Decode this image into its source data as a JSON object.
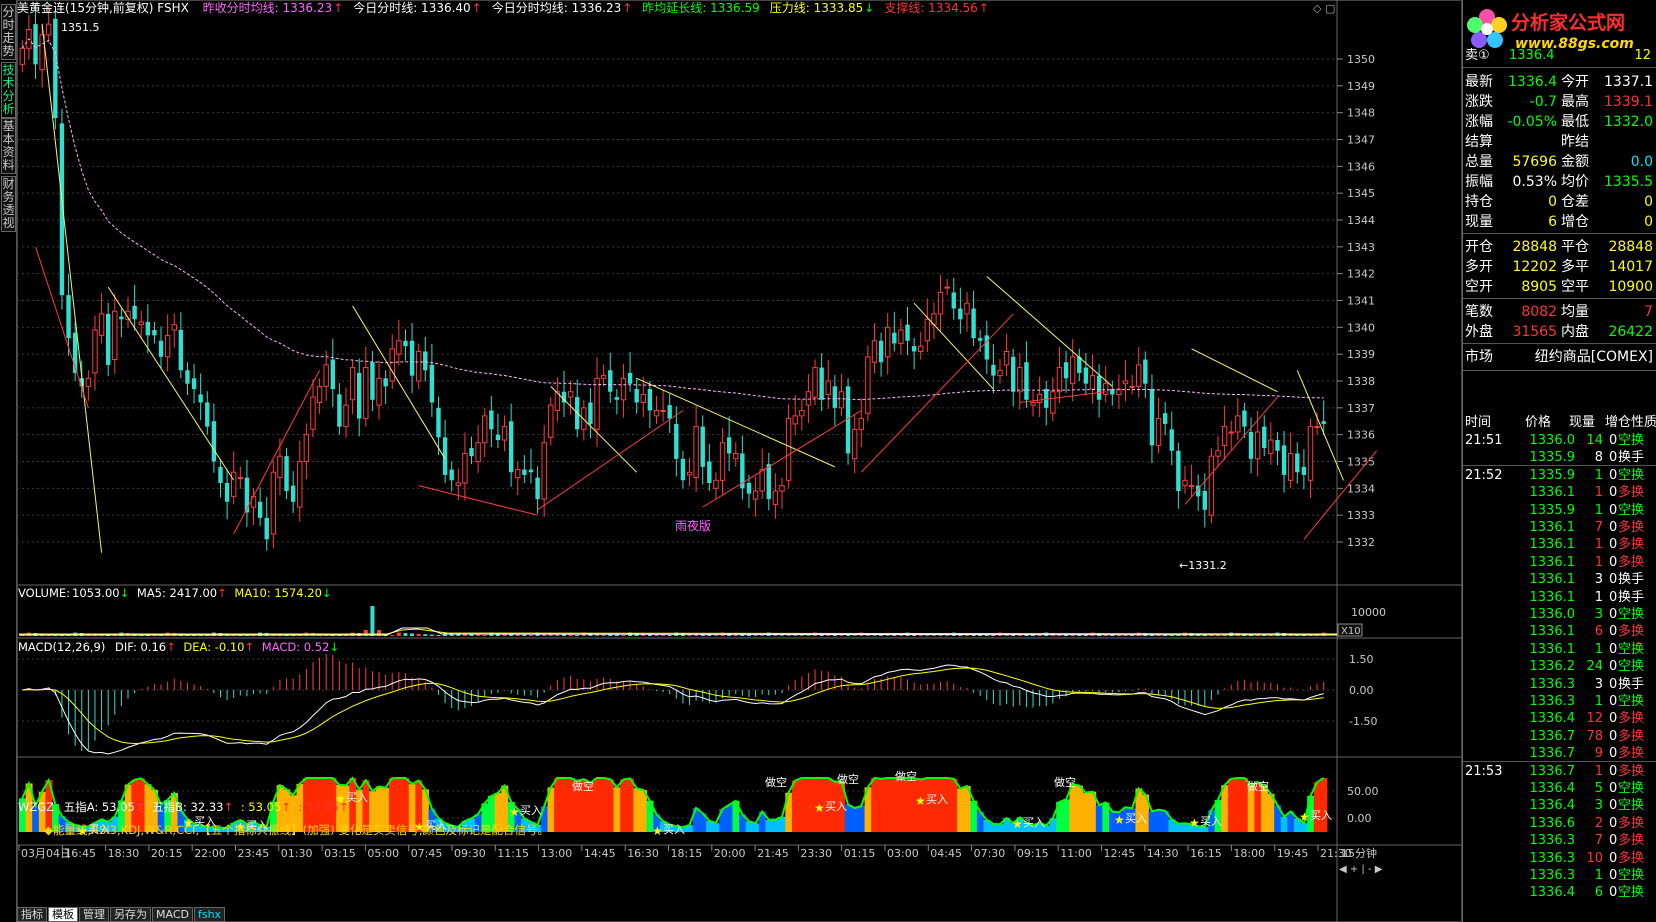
{
  "sidebar": {
    "tabs": [
      "分时走势",
      "技术分析",
      "基本资料",
      "财务透视"
    ],
    "active": 1
  },
  "topbar": {
    "symbol": "美黄金连(15分钟,前复权) FSHX",
    "lines": [
      {
        "label": "昨收分时均线:",
        "value": "1336.23",
        "arrow": "↑",
        "color": "#ff66ff"
      },
      {
        "label": "今日分时线:",
        "value": "1336.40",
        "arrow": "↑",
        "color": "#ffffff"
      },
      {
        "label": "今日分时均线:",
        "value": "1336.23",
        "arrow": "↑",
        "color": "#ffffff"
      },
      {
        "label": "昨均延长线:",
        "value": "1336.59",
        "arrow": "",
        "color": "#00ff00"
      },
      {
        "label": "压力线:",
        "value": "1333.85",
        "arrow": "↓",
        "color": "#ffff00"
      },
      {
        "label": "支撑线:",
        "value": "1334.56",
        "arrow": "↑",
        "color": "#ff3333"
      }
    ]
  },
  "price_axis": [
    "1350",
    "1349",
    "1348",
    "1347",
    "1346",
    "1345",
    "1344",
    "1343",
    "1342",
    "1341",
    "1340",
    "1339",
    "1338",
    "1337",
    "1336",
    "1335",
    "1334",
    "1333",
    "1332"
  ],
  "price_annotations": {
    "high": "1351.5",
    "low": "←1331.2",
    "session": "雨夜版"
  },
  "volume_panel": {
    "label": "VOLUME:",
    "value": "1053.00",
    "ma5": "MA5: 2417.00",
    "ma10": "MA10: 1574.20",
    "axis": "10000",
    "scale": "X10"
  },
  "macd_panel": {
    "label": "MACD(12,26,9)",
    "dif": "DIF: 0.16",
    "dea": "DEA: -0.10",
    "macd": "MACD: 0.52",
    "axis": [
      "1.50",
      "0.00",
      "-1.50"
    ]
  },
  "wzgz_panel": {
    "label": "WZGZ",
    "a": "五指A: 53.05",
    "b": "五指B: 32.33",
    "c": ": 53.05",
    "d": ": 53.05",
    "subtitle": "◆能量线,RSI3,KDJ,W&R,CCI,【五个指标共振线】(加强) 变化是买卖信号,颜色及标记是配合信号。",
    "axis": [
      "50.00",
      "0.00"
    ],
    "buy": "买入",
    "sell": "做空"
  },
  "time_axis": [
    "03月04日",
    "16:45",
    "18:30",
    "20:15",
    "22:00",
    "23:45",
    "01:30",
    "03:15",
    "05:00",
    "07:45",
    "09:30",
    "11:15",
    "13:00",
    "14:45",
    "16:30",
    "18:15",
    "20:00",
    "21:45",
    "23:30",
    "01:15",
    "03:00",
    "04:45",
    "07:30",
    "09:15",
    "11:00",
    "12:45",
    "14:30",
    "16:15",
    "18:00",
    "19:45",
    "21:30"
  ],
  "period_label": "15分钟",
  "bottom_tabs": [
    "指标",
    "模板",
    "管理",
    "另存为",
    "MACD",
    "fshx"
  ],
  "logo": {
    "name": "分析家公式网",
    "url": "www.88gs.com"
  },
  "quote": {
    "ask_row": {
      "label": "卖①",
      "price": "1336.4",
      "vol": "12"
    },
    "rows": [
      [
        {
          "l": "最新",
          "v": "1336.4",
          "c": "#00ff00"
        },
        {
          "l": "今开",
          "v": "1337.1",
          "c": "#ffffff"
        }
      ],
      [
        {
          "l": "涨跌",
          "v": "-0.7",
          "c": "#00ff00"
        },
        {
          "l": "最高",
          "v": "1339.1",
          "c": "#ff3333"
        }
      ],
      [
        {
          "l": "涨幅",
          "v": "-0.05%",
          "c": "#00ff00"
        },
        {
          "l": "最低",
          "v": "1332.0",
          "c": "#00ff00"
        }
      ],
      [
        {
          "l": "结算",
          "v": "",
          "c": "#ffffff"
        },
        {
          "l": "昨结",
          "v": "",
          "c": "#ffffff"
        }
      ],
      [
        {
          "l": "总量",
          "v": "57696",
          "c": "#ffff00"
        },
        {
          "l": "金额",
          "v": "0.0",
          "c": "#00e0ff"
        }
      ],
      [
        {
          "l": "振幅",
          "v": "0.53%",
          "c": "#ffffff"
        },
        {
          "l": "均价",
          "v": "1335.5",
          "c": "#00ff00"
        }
      ],
      [
        {
          "l": "持仓",
          "v": "0",
          "c": "#ffff00"
        },
        {
          "l": "仓差",
          "v": "0",
          "c": "#ffff00"
        }
      ],
      [
        {
          "l": "现量",
          "v": "6",
          "c": "#ffff00"
        },
        {
          "l": "增仓",
          "v": "0",
          "c": "#ffff00"
        }
      ],
      [
        {
          "l": "开仓",
          "v": "28848",
          "c": "#ffff00"
        },
        {
          "l": "平仓",
          "v": "28848",
          "c": "#ffff00"
        }
      ],
      [
        {
          "l": "多开",
          "v": "12202",
          "c": "#ffff00"
        },
        {
          "l": "多平",
          "v": "14017",
          "c": "#ffff00"
        }
      ],
      [
        {
          "l": "空开",
          "v": "8905",
          "c": "#ffff00"
        },
        {
          "l": "空平",
          "v": "10900",
          "c": "#ffff00"
        }
      ],
      [
        {
          "l": "笔数",
          "v": "8082",
          "c": "#ff3333"
        },
        {
          "l": "均量",
          "v": "7",
          "c": "#ff3333"
        }
      ],
      [
        {
          "l": "外盘",
          "v": "31565",
          "c": "#ff3333"
        },
        {
          "l": "内盘",
          "v": "26422",
          "c": "#00ff00"
        }
      ]
    ],
    "market_label": "市场",
    "market_value": "纽约商品[COMEX]"
  },
  "ticks": {
    "headers": [
      "时间",
      "价格",
      "现量",
      "增仓",
      "性质"
    ],
    "rows": [
      {
        "t": "21:51",
        "p": "1336.0",
        "v": "14",
        "i": "0",
        "n": "空换",
        "pc": "#00ff00",
        "vc": "#00ff00",
        "nc": "#00ff00"
      },
      {
        "t": "",
        "p": "1335.9",
        "v": "8",
        "i": "0",
        "n": "换手",
        "pc": "#00ff00",
        "vc": "#ffffff",
        "nc": "#ffffff"
      },
      {
        "t": "21:52",
        "p": "1335.9",
        "v": "1",
        "i": "0",
        "n": "空换",
        "pc": "#00ff00",
        "vc": "#00ff00",
        "nc": "#00ff00"
      },
      {
        "t": "",
        "p": "1336.1",
        "v": "1",
        "i": "0",
        "n": "多换",
        "pc": "#00ff00",
        "vc": "#ff3333",
        "nc": "#ff3333"
      },
      {
        "t": "",
        "p": "1335.9",
        "v": "1",
        "i": "0",
        "n": "空换",
        "pc": "#00ff00",
        "vc": "#00ff00",
        "nc": "#00ff00"
      },
      {
        "t": "",
        "p": "1336.1",
        "v": "7",
        "i": "0",
        "n": "多换",
        "pc": "#00ff00",
        "vc": "#ff3333",
        "nc": "#ff3333"
      },
      {
        "t": "",
        "p": "1336.1",
        "v": "1",
        "i": "0",
        "n": "多换",
        "pc": "#00ff00",
        "vc": "#ff3333",
        "nc": "#ff3333"
      },
      {
        "t": "",
        "p": "1336.1",
        "v": "1",
        "i": "0",
        "n": "多换",
        "pc": "#00ff00",
        "vc": "#ff3333",
        "nc": "#ff3333"
      },
      {
        "t": "",
        "p": "1336.1",
        "v": "3",
        "i": "0",
        "n": "换手",
        "pc": "#00ff00",
        "vc": "#ffffff",
        "nc": "#ffffff"
      },
      {
        "t": "",
        "p": "1336.1",
        "v": "1",
        "i": "0",
        "n": "换手",
        "pc": "#00ff00",
        "vc": "#ffffff",
        "nc": "#ffffff"
      },
      {
        "t": "",
        "p": "1336.0",
        "v": "3",
        "i": "0",
        "n": "空换",
        "pc": "#00ff00",
        "vc": "#00ff00",
        "nc": "#00ff00"
      },
      {
        "t": "",
        "p": "1336.1",
        "v": "6",
        "i": "0",
        "n": "多换",
        "pc": "#00ff00",
        "vc": "#ff3333",
        "nc": "#ff3333"
      },
      {
        "t": "",
        "p": "1336.1",
        "v": "1",
        "i": "0",
        "n": "空换",
        "pc": "#00ff00",
        "vc": "#00ff00",
        "nc": "#00ff00"
      },
      {
        "t": "",
        "p": "1336.2",
        "v": "24",
        "i": "0",
        "n": "空换",
        "pc": "#00ff00",
        "vc": "#00ff00",
        "nc": "#00ff00"
      },
      {
        "t": "",
        "p": "1336.3",
        "v": "3",
        "i": "0",
        "n": "换手",
        "pc": "#00ff00",
        "vc": "#ffffff",
        "nc": "#ffffff"
      },
      {
        "t": "",
        "p": "1336.3",
        "v": "1",
        "i": "0",
        "n": "空换",
        "pc": "#00ff00",
        "vc": "#00ff00",
        "nc": "#00ff00"
      },
      {
        "t": "",
        "p": "1336.4",
        "v": "12",
        "i": "0",
        "n": "多换",
        "pc": "#00ff00",
        "vc": "#ff3333",
        "nc": "#ff3333"
      },
      {
        "t": "",
        "p": "1336.7",
        "v": "78",
        "i": "0",
        "n": "多换",
        "pc": "#00ff00",
        "vc": "#ff3333",
        "nc": "#ff3333"
      },
      {
        "t": "",
        "p": "1336.7",
        "v": "9",
        "i": "0",
        "n": "多换",
        "pc": "#00ff00",
        "vc": "#ff3333",
        "nc": "#ff3333"
      },
      {
        "t": "21:53",
        "p": "1336.7",
        "v": "1",
        "i": "0",
        "n": "多换",
        "pc": "#00ff00",
        "vc": "#ff3333",
        "nc": "#ff3333"
      },
      {
        "t": "",
        "p": "1336.4",
        "v": "5",
        "i": "0",
        "n": "空换",
        "pc": "#00ff00",
        "vc": "#00ff00",
        "nc": "#00ff00"
      },
      {
        "t": "",
        "p": "1336.4",
        "v": "3",
        "i": "0",
        "n": "空换",
        "pc": "#00ff00",
        "vc": "#00ff00",
        "nc": "#00ff00"
      },
      {
        "t": "",
        "p": "1336.6",
        "v": "2",
        "i": "0",
        "n": "多换",
        "pc": "#00ff00",
        "vc": "#ff3333",
        "nc": "#ff3333"
      },
      {
        "t": "",
        "p": "1336.3",
        "v": "7",
        "i": "0",
        "n": "多换",
        "pc": "#00ff00",
        "vc": "#ff3333",
        "nc": "#ff3333"
      },
      {
        "t": "",
        "p": "1336.3",
        "v": "10",
        "i": "0",
        "n": "多换",
        "pc": "#00ff00",
        "vc": "#ff3333",
        "nc": "#ff3333"
      },
      {
        "t": "",
        "p": "1336.3",
        "v": "1",
        "i": "0",
        "n": "空换",
        "pc": "#00ff00",
        "vc": "#00ff00",
        "nc": "#00ff00"
      },
      {
        "t": "",
        "p": "1336.4",
        "v": "6",
        "i": "0",
        "n": "空换",
        "pc": "#00ff00",
        "vc": "#00ff00",
        "nc": "#00ff00"
      }
    ]
  },
  "chart_data": {
    "type": "candlestick",
    "series": [
      {
        "name": "美黄金连",
        "close": [
          1350.4,
          1351.1,
          1349.8,
          1350.9,
          1351.3,
          1347.8,
          1341.2,
          1339.6,
          1338.3,
          1337.8,
          1338.1,
          1339.9,
          1340.5,
          1338.6,
          1340.6,
          1340.3,
          1340.6,
          1340.3,
          1340.2,
          1339.7,
          1339.7,
          1338.9,
          1339.7,
          1340.1,
          1338.4,
          1337.9,
          1337.7,
          1337.2,
          1336.3,
          1335.0,
          1334.2,
          1333.5,
          1334.6,
          1334.4,
          1333.1,
          1333.7,
          1332.9,
          1332.1,
          1334.6,
          1335.2,
          1333.9,
          1333.5,
          1335.0,
          1336.0,
          1337.4,
          1337.8,
          1338.6,
          1337.7,
          1336.3,
          1337.1,
          1338.5,
          1336.6,
          1338.5,
          1337.3,
          1338.1,
          1337.8,
          1339.2,
          1339.5,
          1339.3,
          1338.2,
          1339.1,
          1338.4,
          1337.2,
          1335.9,
          1334.5,
          1334.3,
          1334.2,
          1335.3,
          1335.2,
          1335.7,
          1336.7,
          1336.2,
          1335.8,
          1336.3,
          1334.6,
          1334.7,
          1334.5,
          1334.6,
          1333.6,
          1335.7,
          1337.1,
          1337.6,
          1337.2,
          1337.6,
          1336.2,
          1337.0,
          1336.4,
          1338.1,
          1338.2,
          1337.6,
          1337.3,
          1338.1,
          1337.9,
          1337.2,
          1337.5,
          1336.9,
          1336.9,
          1336.9,
          1336.6,
          1335.1,
          1334.3,
          1334.6,
          1336.3,
          1334.8,
          1334.2,
          1334.3,
          1335.7,
          1335.3,
          1335.3,
          1334.0,
          1333.8,
          1333.9,
          1334.7,
          1333.6,
          1333.9,
          1334.1,
          1336.6,
          1336.7,
          1336.9,
          1337.6,
          1338.5,
          1337.3,
          1338.0,
          1337.0,
          1337.6,
          1335.3,
          1336.2,
          1336.6,
          1338.9,
          1339.5,
          1338.7,
          1340.0,
          1339.4,
          1339.9,
          1339.5,
          1339.1,
          1339.3,
          1340.3,
          1340.5,
          1341.3,
          1341.5,
          1340.7,
          1340.3,
          1340.9,
          1339.6,
          1339.5,
          1338.8,
          1338.2,
          1338.4,
          1339.1,
          1337.6,
          1338.5,
          1337.3,
          1337.2,
          1337.5,
          1337.0,
          1337.6,
          1338.5,
          1338.1,
          1338.9,
          1338.3,
          1337.9,
          1338.2,
          1337.3,
          1337.9,
          1337.5,
          1337.7,
          1338.0,
          1337.8,
          1338.6,
          1337.9,
          1335.6,
          1336.6,
          1336.4,
          1335.4,
          1333.9,
          1334.3,
          1334.1,
          1333.7,
          1333.2,
          1335.2,
          1335.4,
          1336.3,
          1336.1,
          1336.7,
          1336.3,
          1335.1,
          1336.1,
          1335.5,
          1335.8,
          1335.4,
          1334.5,
          1335.3,
          1334.6,
          1334.5,
          1336.3,
          1336.3,
          1336.4
        ]
      }
    ],
    "ylim": [
      1331,
      1351.5
    ],
    "xlabel": "",
    "ylabel": ""
  }
}
